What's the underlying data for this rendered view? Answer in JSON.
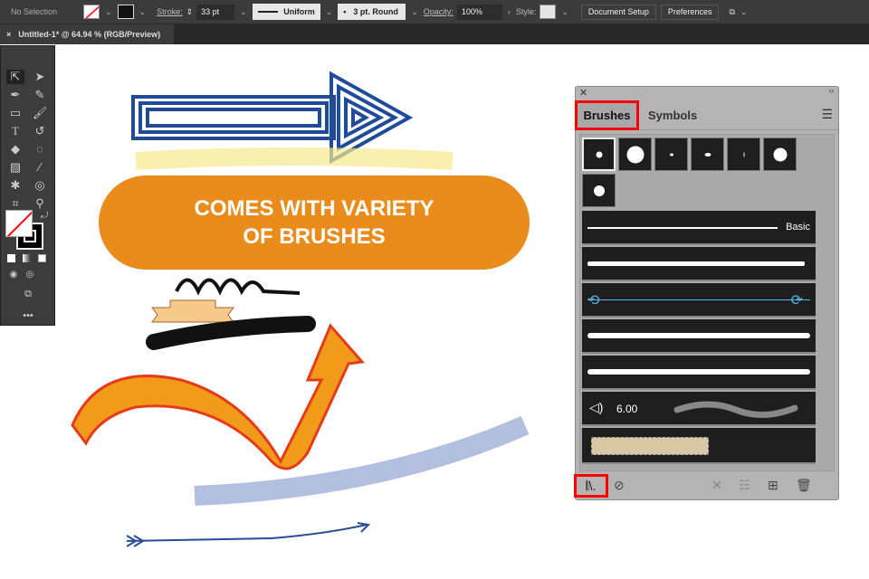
{
  "control_bar": {
    "selection": "No Selection",
    "stroke_label": "Stroke:",
    "stroke_value": "33 pt",
    "profile": "Uniform",
    "brush": "3 pt. Round",
    "opacity_label": "Opacity:",
    "opacity_value": "100%",
    "style_label": "Style:",
    "document_setup": "Document Setup",
    "preferences": "Preferences"
  },
  "document_tab": {
    "title": "Untitled-1* @ 64.94 % (RGB/Preview)",
    "close": "×"
  },
  "banner": {
    "line1": "COMES WITH VARIETY",
    "line2": "OF BRUSHES",
    "color": "#ea8c1c"
  },
  "brushes_panel": {
    "tabs": [
      "Brushes",
      "Symbols"
    ],
    "active_tab": "Brushes",
    "basic_label": "Basic",
    "bristle_value": "6.00",
    "highlight_color": "#ff0000"
  }
}
